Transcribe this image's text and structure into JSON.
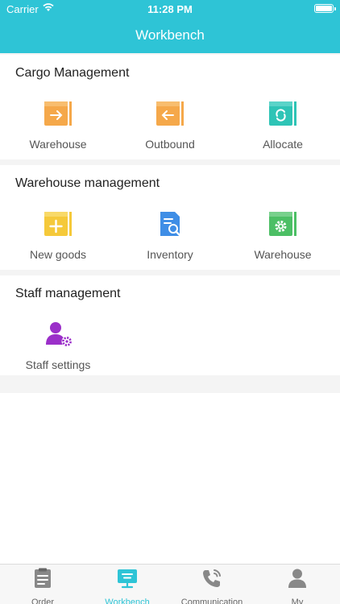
{
  "status_bar": {
    "carrier": "Carrier",
    "time": "11:28 PM"
  },
  "header": {
    "title": "Workbench"
  },
  "sections": [
    {
      "title": "Cargo Management",
      "items": [
        {
          "label": "Warehouse",
          "icon": "warehouse-in-icon",
          "color": "#f5a84a"
        },
        {
          "label": "Outbound",
          "icon": "outbound-icon",
          "color": "#f5a84a"
        },
        {
          "label": "Allocate",
          "icon": "allocate-icon",
          "color": "#2ec4b6"
        }
      ]
    },
    {
      "title": "Warehouse management",
      "items": [
        {
          "label": "New goods",
          "icon": "new-goods-icon",
          "color": "#f5c93a"
        },
        {
          "label": "Inventory",
          "icon": "inventory-icon",
          "color": "#3f8ee6"
        },
        {
          "label": "Warehouse",
          "icon": "warehouse-settings-icon",
          "color": "#4cbf65"
        }
      ]
    },
    {
      "title": "Staff management",
      "items": [
        {
          "label": "Staff settings",
          "icon": "staff-settings-icon",
          "color": "#9b2fc9"
        }
      ]
    }
  ],
  "tabbar": {
    "items": [
      {
        "label": "Order",
        "icon": "order-icon",
        "active": false
      },
      {
        "label": "Workbench",
        "icon": "workbench-icon",
        "active": true
      },
      {
        "label": "Communication",
        "icon": "phone-icon",
        "active": false
      },
      {
        "label": "My",
        "icon": "person-icon",
        "active": false
      }
    ],
    "active_color": "#2ec4d6"
  }
}
